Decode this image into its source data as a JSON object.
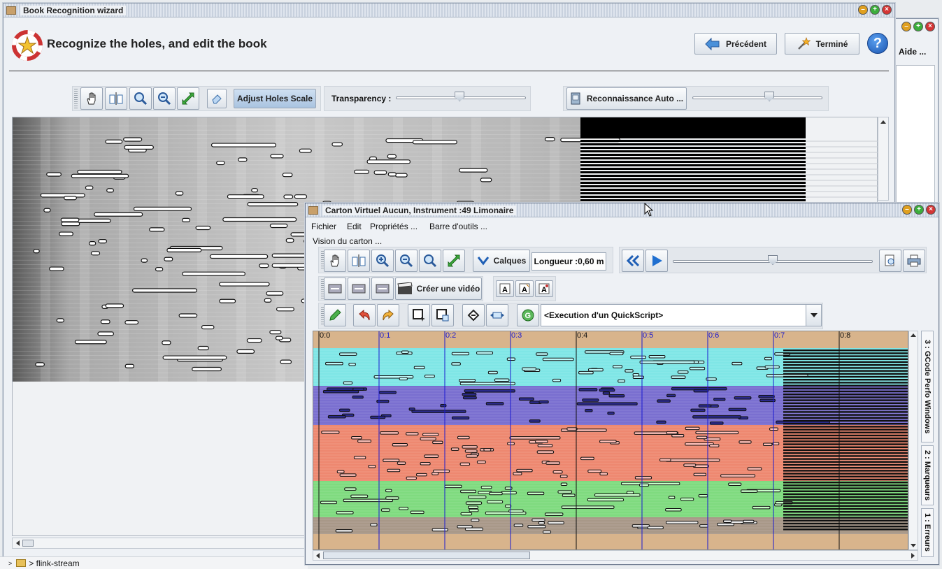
{
  "background_window": {
    "help_label": "Aide ..."
  },
  "wizard": {
    "title": "Book Recognition wizard",
    "heading": "Recognize the holes, and edit the book",
    "previous_label": "Précédent",
    "finish_label": "Terminé",
    "help_symbol": "?",
    "toolbar": {
      "adjust_label": "Adjust Holes Scale",
      "transparency_label": "Transparency :",
      "transparency_value": 0.49,
      "auto_recog_label": "Reconnaissance Auto ...",
      "auto_recog_value": 0.6
    }
  },
  "taskbar": {
    "crumb": "> flink-stream"
  },
  "carton": {
    "title": "Carton Virtuel  Aucun, Instrument :49 Limonaire",
    "menu": [
      "Fichier",
      "Edit",
      "Propriétés ...",
      "Barre d'outils ..."
    ],
    "section_label": "Vision du carton ...",
    "calques_label": "Calques",
    "length_label": "Longueur :0,60 m",
    "zoom_value": 0.5,
    "video_label": "Créer une vidéo",
    "quickscript_value": "<Execution d'un QuickScript>",
    "ruler_labels": [
      "0:0",
      "0:1",
      "0:2",
      "0:3",
      "0:4",
      "0:5",
      "0:6",
      "0:7",
      "0:8"
    ],
    "side_tabs": [
      "3 : GCode Perfo Windows",
      "2 : Marqueurs",
      "1 : Erreurs"
    ],
    "band_colors": {
      "cyan": "#7fe6e6",
      "violet": "#7a6fd0",
      "salmon": "#ee8870",
      "green": "#7fdb7f",
      "tan": "#d8b48c"
    }
  }
}
